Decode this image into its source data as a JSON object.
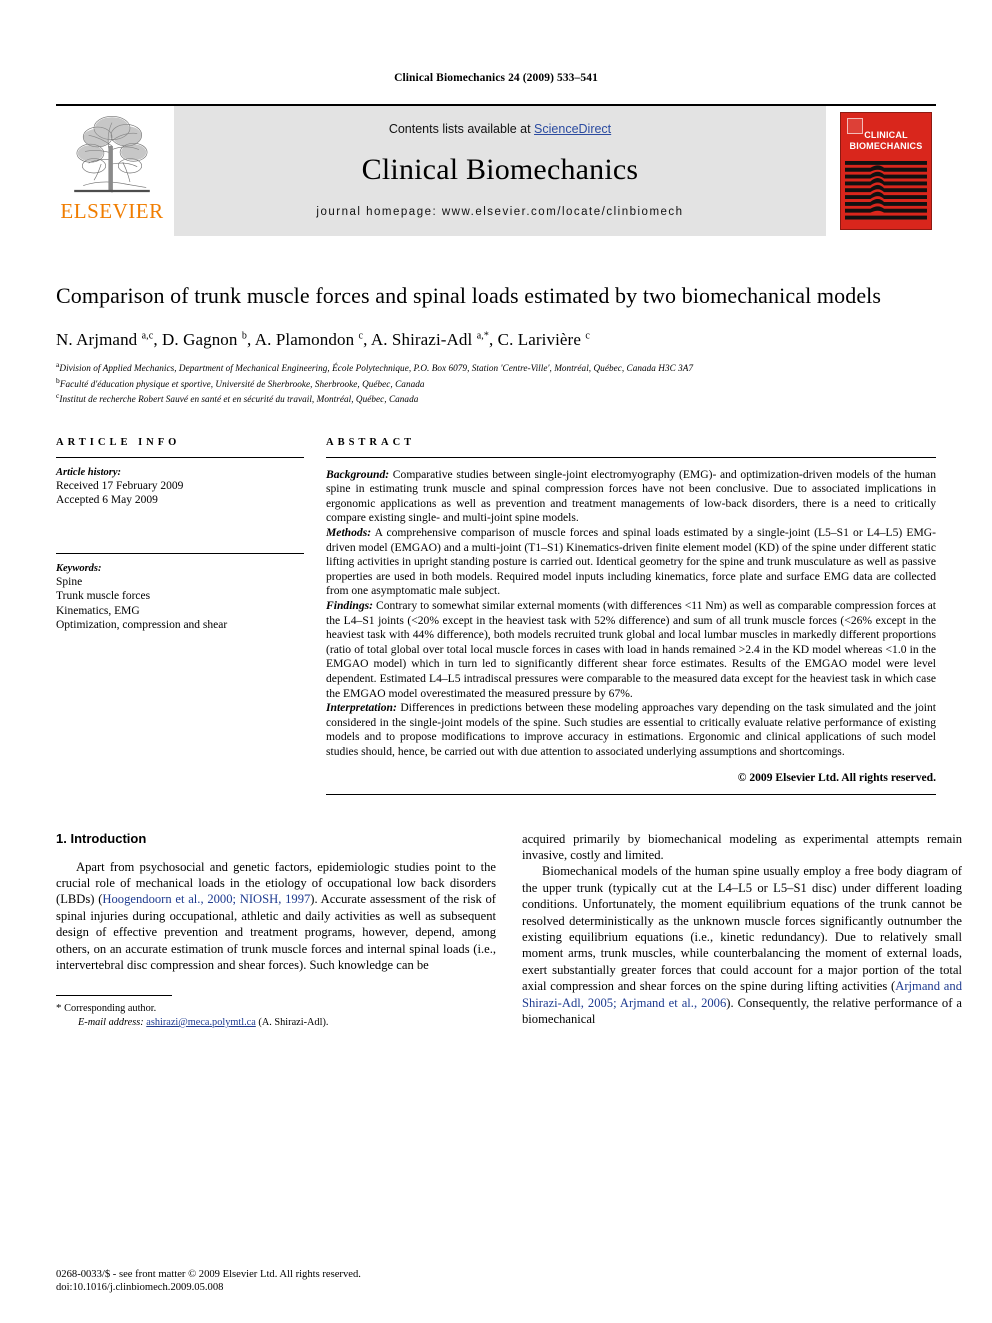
{
  "running_head": "Clinical Biomechanics 24 (2009) 533–541",
  "banner": {
    "publisher_name": "ELSEVIER",
    "contents_prefix": "Contents lists available at ",
    "contents_link": "ScienceDirect",
    "journal_name": "Clinical Biomechanics",
    "homepage_line": "journal homepage: www.elsevier.com/locate/clinbiomech",
    "cover_title_line1": "CLINICAL",
    "cover_title_line2": "BIOMECHANICS",
    "cover_color": "#d9261c",
    "link_color": "#2b4ba0",
    "elsevier_color": "#f07d00"
  },
  "article": {
    "title": "Comparison of trunk muscle forces and spinal loads estimated by two biomechanical models",
    "authors_html": "N. Arjmand <sup>a,c</sup>, D. Gagnon <sup>b</sup>, A. Plamondon <sup>c</sup>, A. Shirazi-Adl <sup>a,*</sup>, C. Larivière <sup>c</sup>",
    "affiliations": [
      {
        "mark": "a",
        "text": "Division of Applied Mechanics, Department of Mechanical Engineering, École Polytechnique, P.O. Box 6079, Station 'Centre-Ville', Montréal, Québec, Canada H3C 3A7"
      },
      {
        "mark": "b",
        "text": "Faculté d'éducation physique et sportive, Université de Sherbrooke, Sherbrooke, Québec, Canada"
      },
      {
        "mark": "c",
        "text": "Institut de recherche Robert Sauvé en santé et en sécurité du travail, Montréal, Québec, Canada"
      }
    ]
  },
  "article_info": {
    "heading": "ARTICLE INFO",
    "history_label": "Article history:",
    "history_lines": [
      "Received 17 February 2009",
      "Accepted 6 May 2009"
    ],
    "keywords_label": "Keywords:",
    "keywords": [
      "Spine",
      "Trunk muscle forces",
      "Kinematics, EMG",
      "Optimization, compression and shear"
    ]
  },
  "abstract": {
    "heading": "ABSTRACT",
    "sections": [
      {
        "label": "Background:",
        "text": " Comparative studies between single-joint electromyography (EMG)- and optimization-driven models of the human spine in estimating trunk muscle and spinal compression forces have not been conclusive. Due to associated implications in ergonomic applications as well as prevention and treatment managements of low-back disorders, there is a need to critically compare existing single- and multi-joint spine models."
      },
      {
        "label": "Methods:",
        "text": " A comprehensive comparison of muscle forces and spinal loads estimated by a single-joint (L5–S1 or L4–L5) EMG-driven model (EMGAO) and a multi-joint (T1–S1) Kinematics-driven finite element model (KD) of the spine under different static lifting activities in upright standing posture is carried out. Identical geometry for the spine and trunk musculature as well as passive properties are used in both models. Required model inputs including kinematics, force plate and surface EMG data are collected from one asymptomatic male subject."
      },
      {
        "label": "Findings:",
        "text": " Contrary to somewhat similar external moments (with differences <11 Nm) as well as comparable compression forces at the L4–S1 joints (<20% except in the heaviest task with 52% difference) and sum of all trunk muscle forces (<26% except in the heaviest task with 44% difference), both models recruited trunk global and local lumbar muscles in markedly different proportions (ratio of total global over total local muscle forces in cases with load in hands remained >2.4 in the KD model whereas <1.0 in the EMGAO model) which in turn led to significantly different shear force estimates. Results of the EMGAO model were level dependent. Estimated L4–L5 intradiscal pressures were comparable to the measured data except for the heaviest task in which case the EMGAO model overestimated the measured pressure by 67%."
      },
      {
        "label": "Interpretation:",
        "text": " Differences in predictions between these modeling approaches vary depending on the task simulated and the joint considered in the single-joint models of the spine. Such studies are essential to critically evaluate relative performance of existing models and to propose modifications to improve accuracy in estimations. Ergonomic and clinical applications of such model studies should, hence, be carried out with due attention to associated underlying assumptions and shortcomings."
      }
    ],
    "copyright": "© 2009 Elsevier Ltd. All rights reserved."
  },
  "body": {
    "section_number_title": "1. Introduction",
    "left_paragraph_parts": [
      {
        "type": "text",
        "value": "Apart from psychosocial and genetic factors, epidemiologic studies point to the crucial role of mechanical loads in the etiology of occupational low back disorders (LBDs) ("
      },
      {
        "type": "cite",
        "value": "Hoogendoorn et al., 2000; NIOSH, 1997"
      },
      {
        "type": "text",
        "value": "). Accurate assessment of the risk of spinal injuries during occupational, athletic and daily activities as well as subsequent design of effective prevention and treatment programs, however, depend, among others, on an accurate estimation of trunk muscle forces and internal spinal loads (i.e., intervertebral disc compression and shear forces). Such knowledge can be"
      }
    ],
    "right_paragraph1": "acquired primarily by biomechanical modeling as experimental attempts remain invasive, costly and limited.",
    "right_paragraph2_parts": [
      {
        "type": "text",
        "value": "Biomechanical models of the human spine usually employ a free body diagram of the upper trunk (typically cut at the L4–L5 or L5–S1 disc) under different loading conditions. Unfortunately, the moment equilibrium equations of the trunk cannot be resolved deterministically as the unknown muscle forces significantly outnumber the existing equilibrium equations (i.e., kinetic redundancy). Due to relatively small moment arms, trunk muscles, while counterbalancing the moment of external loads, exert substantially greater forces that could account for a major portion of the total axial compression and shear forces on the spine during lifting activities ("
      },
      {
        "type": "cite",
        "value": "Arjmand and Shirazi-Adl, 2005; Arjmand et al., 2006"
      },
      {
        "type": "text",
        "value": "). Consequently, the relative performance of a biomechanical"
      }
    ]
  },
  "footnotes": {
    "corresponding_star": "*",
    "corresponding_text": "Corresponding author.",
    "email_label": "E-mail address:",
    "email": "ashirazi@meca.polymtl.ca",
    "email_suffix": " (A. Shirazi-Adl)."
  },
  "publisher_footer": {
    "line1": "0268-0033/$ - see front matter © 2009 Elsevier Ltd. All rights reserved.",
    "line2": "doi:10.1016/j.clinbiomech.2009.05.008"
  }
}
